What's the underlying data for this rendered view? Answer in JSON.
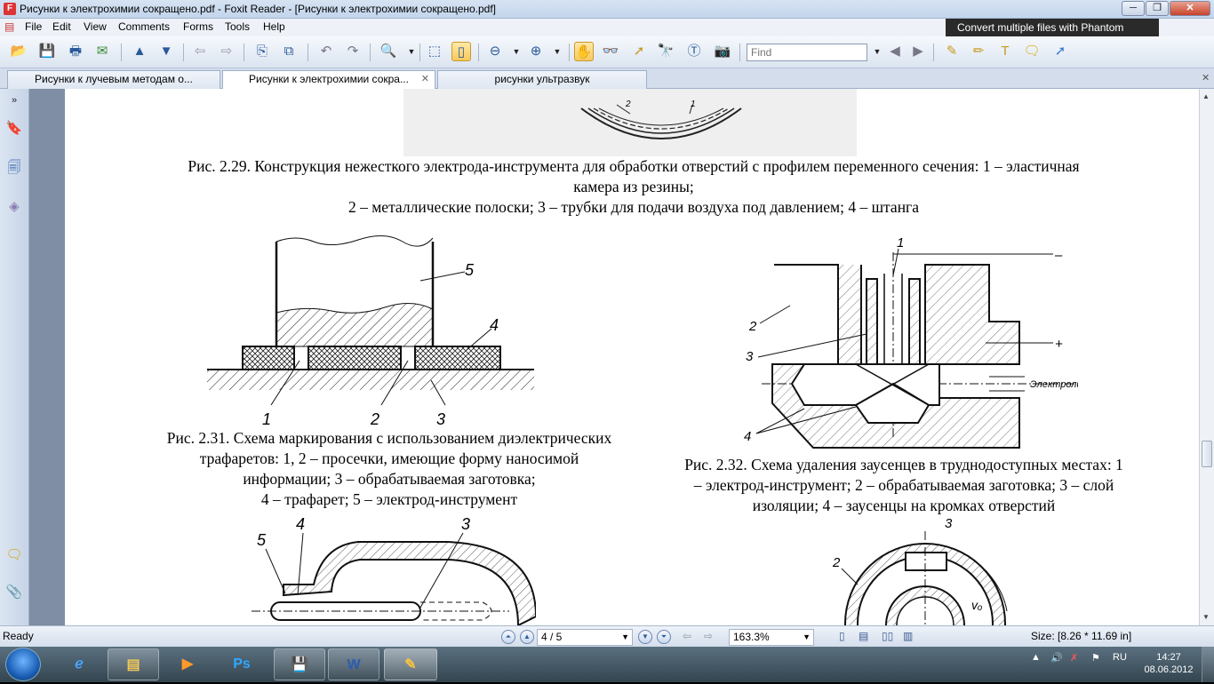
{
  "window": {
    "title": "Рисунки к электрохимии сокращено.pdf - Foxit Reader - [Рисунки к электрохимии сокращено.pdf]",
    "controls": {
      "minimize": "─",
      "restore": "❐",
      "close": "✕"
    }
  },
  "menu": [
    "File",
    "Edit",
    "View",
    "Comments",
    "Forms",
    "Tools",
    "Help"
  ],
  "promo": "Convert multiple files with Phantom",
  "toolbar": {
    "find_placeholder": "Find"
  },
  "tabs": [
    {
      "label": "Рисунки к лучевым методам о...",
      "active": false
    },
    {
      "label": "Рисунки к электрохимии сокра...",
      "active": true,
      "close": "✕"
    },
    {
      "label": "рисунки ультразвук",
      "active": false
    }
  ],
  "document": {
    "fig229": {
      "line1": "Рис. 2.29. Конструкция нежесткого электрода-инструмента для обработки отверстий с профилем переменного сечения: 1 – эластичная",
      "line2": "камера из резины;",
      "line3": "2 – металлические полоски; 3 – трубки для подачи воздуха под давлением; 4 – штанга",
      "labels": [
        "2",
        "1"
      ]
    },
    "fig231": {
      "line1": "Рис. 2.31. Схема маркирования с использованием диэлектрических",
      "line2": "трафаретов: 1, 2 – просечки, имеющие форму наносимой",
      "line3": "информации; 3 – обрабатываемая заготовка;",
      "line4": "4 – трафарет; 5 – электрод-инструмент",
      "labels": [
        "5",
        "4",
        "1",
        "2",
        "3"
      ]
    },
    "fig232": {
      "line1": "Рис. 2.32. Схема удаления заусенцев в труднодоступных местах: 1",
      "line2": "– электрод-инструмент; 2 – обрабатываемая заготовка; 3 – слой",
      "line3": "изоляции; 4 – заусенцы на кромках отверстий",
      "labels": [
        "1",
        "2",
        "3",
        "4",
        "–",
        "+",
        "Электролит"
      ]
    },
    "fig_bottom_left": {
      "labels": [
        "5",
        "4",
        "3"
      ]
    },
    "fig_bottom_right": {
      "labels": [
        "3",
        "2",
        "vₒ"
      ]
    }
  },
  "status": {
    "ready": "Ready",
    "page": "4 / 5",
    "zoom": "163.3%",
    "size": "Size: [8.26 * 11.69 in]"
  },
  "taskbar": {
    "apps": [
      "IE",
      "Explorer",
      "Media",
      "Ps",
      "Save",
      "W",
      "Foxit"
    ],
    "lang": "RU",
    "time": "14:27",
    "date": "08.06.2012"
  }
}
